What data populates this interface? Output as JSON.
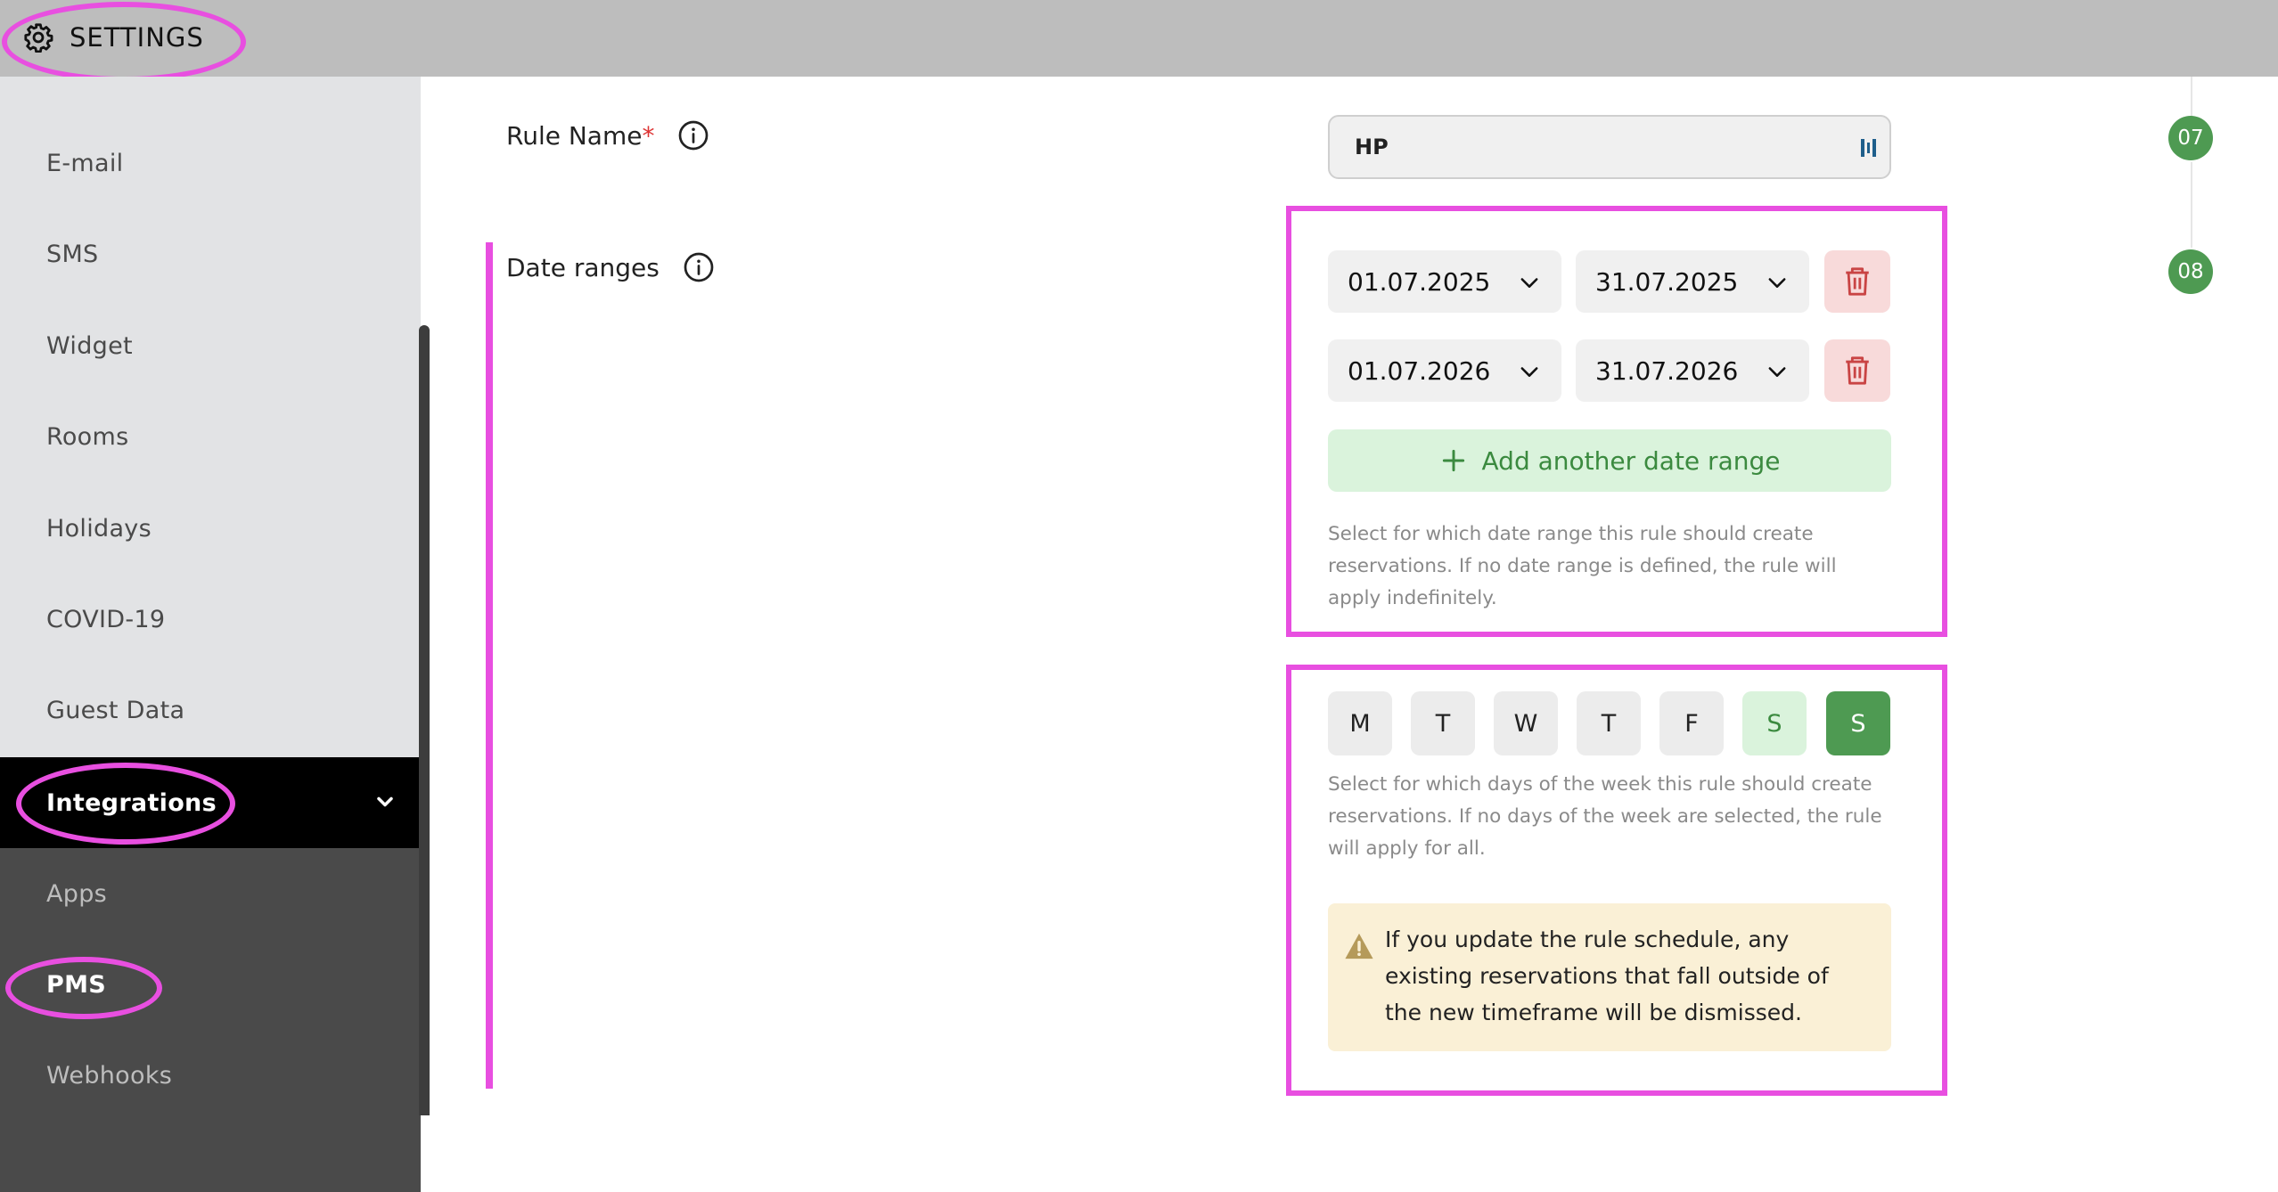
{
  "header": {
    "title": "SETTINGS",
    "icon": "gear-icon"
  },
  "sidebar": {
    "items": [
      {
        "label": "E-mail"
      },
      {
        "label": "SMS"
      },
      {
        "label": "Widget"
      },
      {
        "label": "Rooms"
      },
      {
        "label": "Holidays"
      },
      {
        "label": "COVID-19"
      },
      {
        "label": "Guest Data"
      },
      {
        "label": "Integrations",
        "expanded": true
      },
      {
        "label": "Apps"
      },
      {
        "label": "PMS",
        "selected": true
      },
      {
        "label": "Webhooks"
      }
    ]
  },
  "form": {
    "rule_name": {
      "label": "Rule Name",
      "required_mark": "*",
      "value": "HP"
    },
    "date_ranges": {
      "label": "Date ranges",
      "ranges": [
        {
          "from": "01.07.2025",
          "to": "31.07.2025"
        },
        {
          "from": "01.07.2026",
          "to": "31.07.2026"
        }
      ],
      "add_label": "Add another date range",
      "help": "Select for which date range this rule should create reservations. If no date range is defined, the rule will apply indefinitely."
    },
    "weekdays": {
      "days": [
        {
          "label": "M",
          "state": "off"
        },
        {
          "label": "T",
          "state": "off"
        },
        {
          "label": "W",
          "state": "off"
        },
        {
          "label": "T",
          "state": "off"
        },
        {
          "label": "F",
          "state": "off"
        },
        {
          "label": "S",
          "state": "hover"
        },
        {
          "label": "S",
          "state": "on"
        }
      ],
      "help": "Select for which days of the week this rule should create reservations. If no days of the week are selected, the rule will apply for all."
    },
    "warning": "If you update the rule schedule, any existing reservations that fall outside of the new timeframe will be dismissed."
  },
  "steps": [
    "07",
    "08"
  ],
  "colors": {
    "accent_green": "#4e9a52",
    "annotation_magenta": "#e84fe0",
    "sidebar_active": "#000000"
  }
}
